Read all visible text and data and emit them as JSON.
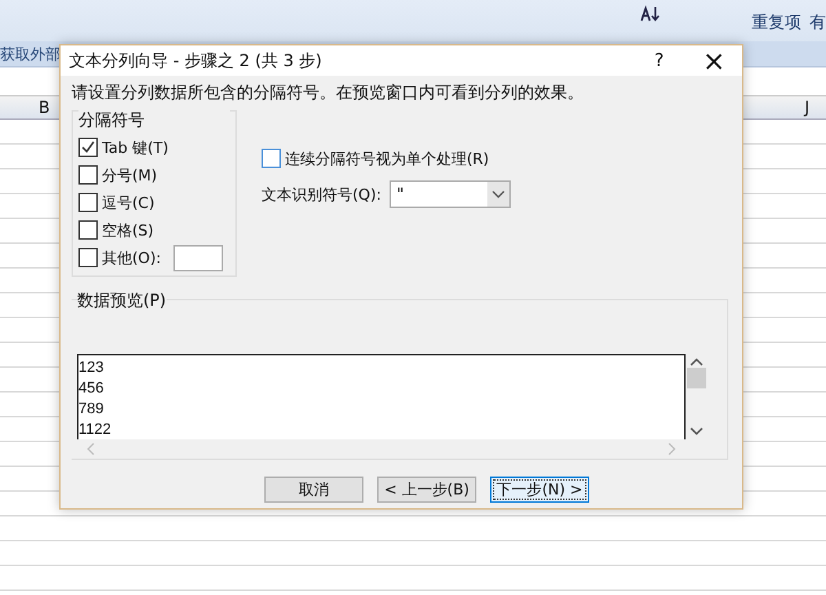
{
  "ribbon": {
    "group_label": "获取外部",
    "command": "重复项",
    "command_cut": "有"
  },
  "columns": [
    "B",
    "J"
  ],
  "dialog": {
    "title": "文本分列向导 - 步骤之 2 (共 3 步)",
    "help": "?",
    "close": "×",
    "instruction": "请设置分列数据所包含的分隔符号。在预览窗口内可看到分列的效果。",
    "delimiters": {
      "legend": "分隔符号",
      "options": [
        {
          "label": "Tab 键(T)",
          "checked": true
        },
        {
          "label": "分号(M)",
          "checked": false
        },
        {
          "label": "逗号(C)",
          "checked": false
        },
        {
          "label": "空格(S)",
          "checked": false
        },
        {
          "label": "其他(O):",
          "checked": false,
          "kind": "other"
        }
      ]
    },
    "consecutive": {
      "label": "连续分隔符号视为单个处理(R)",
      "checked": false
    },
    "qualifier": {
      "label": "文本识别符号(Q):",
      "value": "\""
    },
    "preview": {
      "legend": "数据预览(P)",
      "rows": [
        "123",
        "456",
        "789",
        "1122"
      ]
    },
    "buttons": [
      {
        "label": "取消",
        "focused": false
      },
      {
        "label": "< 上一步(B)",
        "focused": false
      },
      {
        "label": "下一步(N) >",
        "focused": true
      }
    ]
  }
}
